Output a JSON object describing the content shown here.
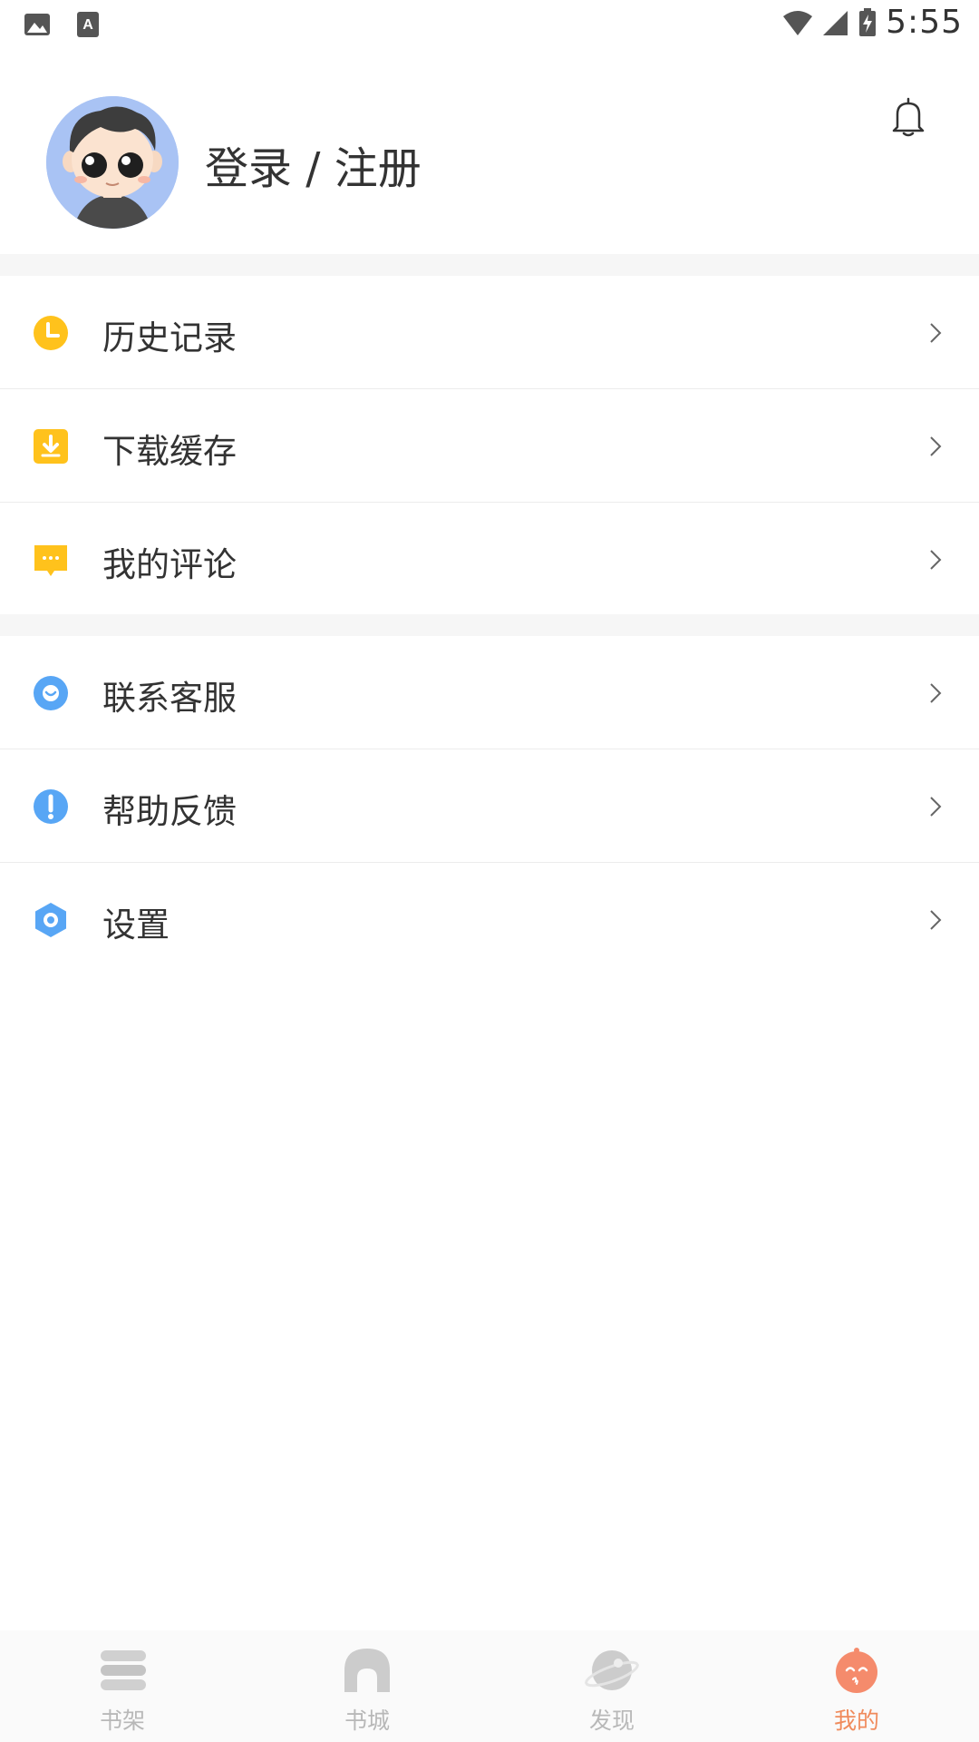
{
  "status_bar": {
    "time": "5:55",
    "icons": [
      "image-icon",
      "font-icon",
      "wifi-icon",
      "signal-icon",
      "battery-icon"
    ]
  },
  "profile": {
    "avatar_icon": "avatar",
    "login_label": "登录 / 注册",
    "bell_icon": "bell-icon"
  },
  "menu_group_1": [
    {
      "label": "历史记录",
      "icon": "history-clock-icon",
      "color": "#ffc21c"
    },
    {
      "label": "下载缓存",
      "icon": "download-icon",
      "color": "#ffc21c"
    },
    {
      "label": "我的评论",
      "icon": "comment-icon",
      "color": "#ffc21c"
    }
  ],
  "menu_group_2": [
    {
      "label": "联系客服",
      "icon": "customer-service-icon",
      "color": "#58a6f5"
    },
    {
      "label": "帮助反馈",
      "icon": "feedback-icon",
      "color": "#58a6f5"
    },
    {
      "label": "设置",
      "icon": "settings-icon",
      "color": "#58a6f5"
    }
  ],
  "bottom_nav": {
    "items": [
      {
        "label": "书架",
        "icon": "bookshelf-icon",
        "active": false
      },
      {
        "label": "书城",
        "icon": "bookstore-icon",
        "active": false
      },
      {
        "label": "发现",
        "icon": "discover-icon",
        "active": false
      },
      {
        "label": "我的",
        "icon": "mine-icon",
        "active": true
      }
    ],
    "active_color": "#f08b5c",
    "inactive_color": "#c8c8c8"
  }
}
